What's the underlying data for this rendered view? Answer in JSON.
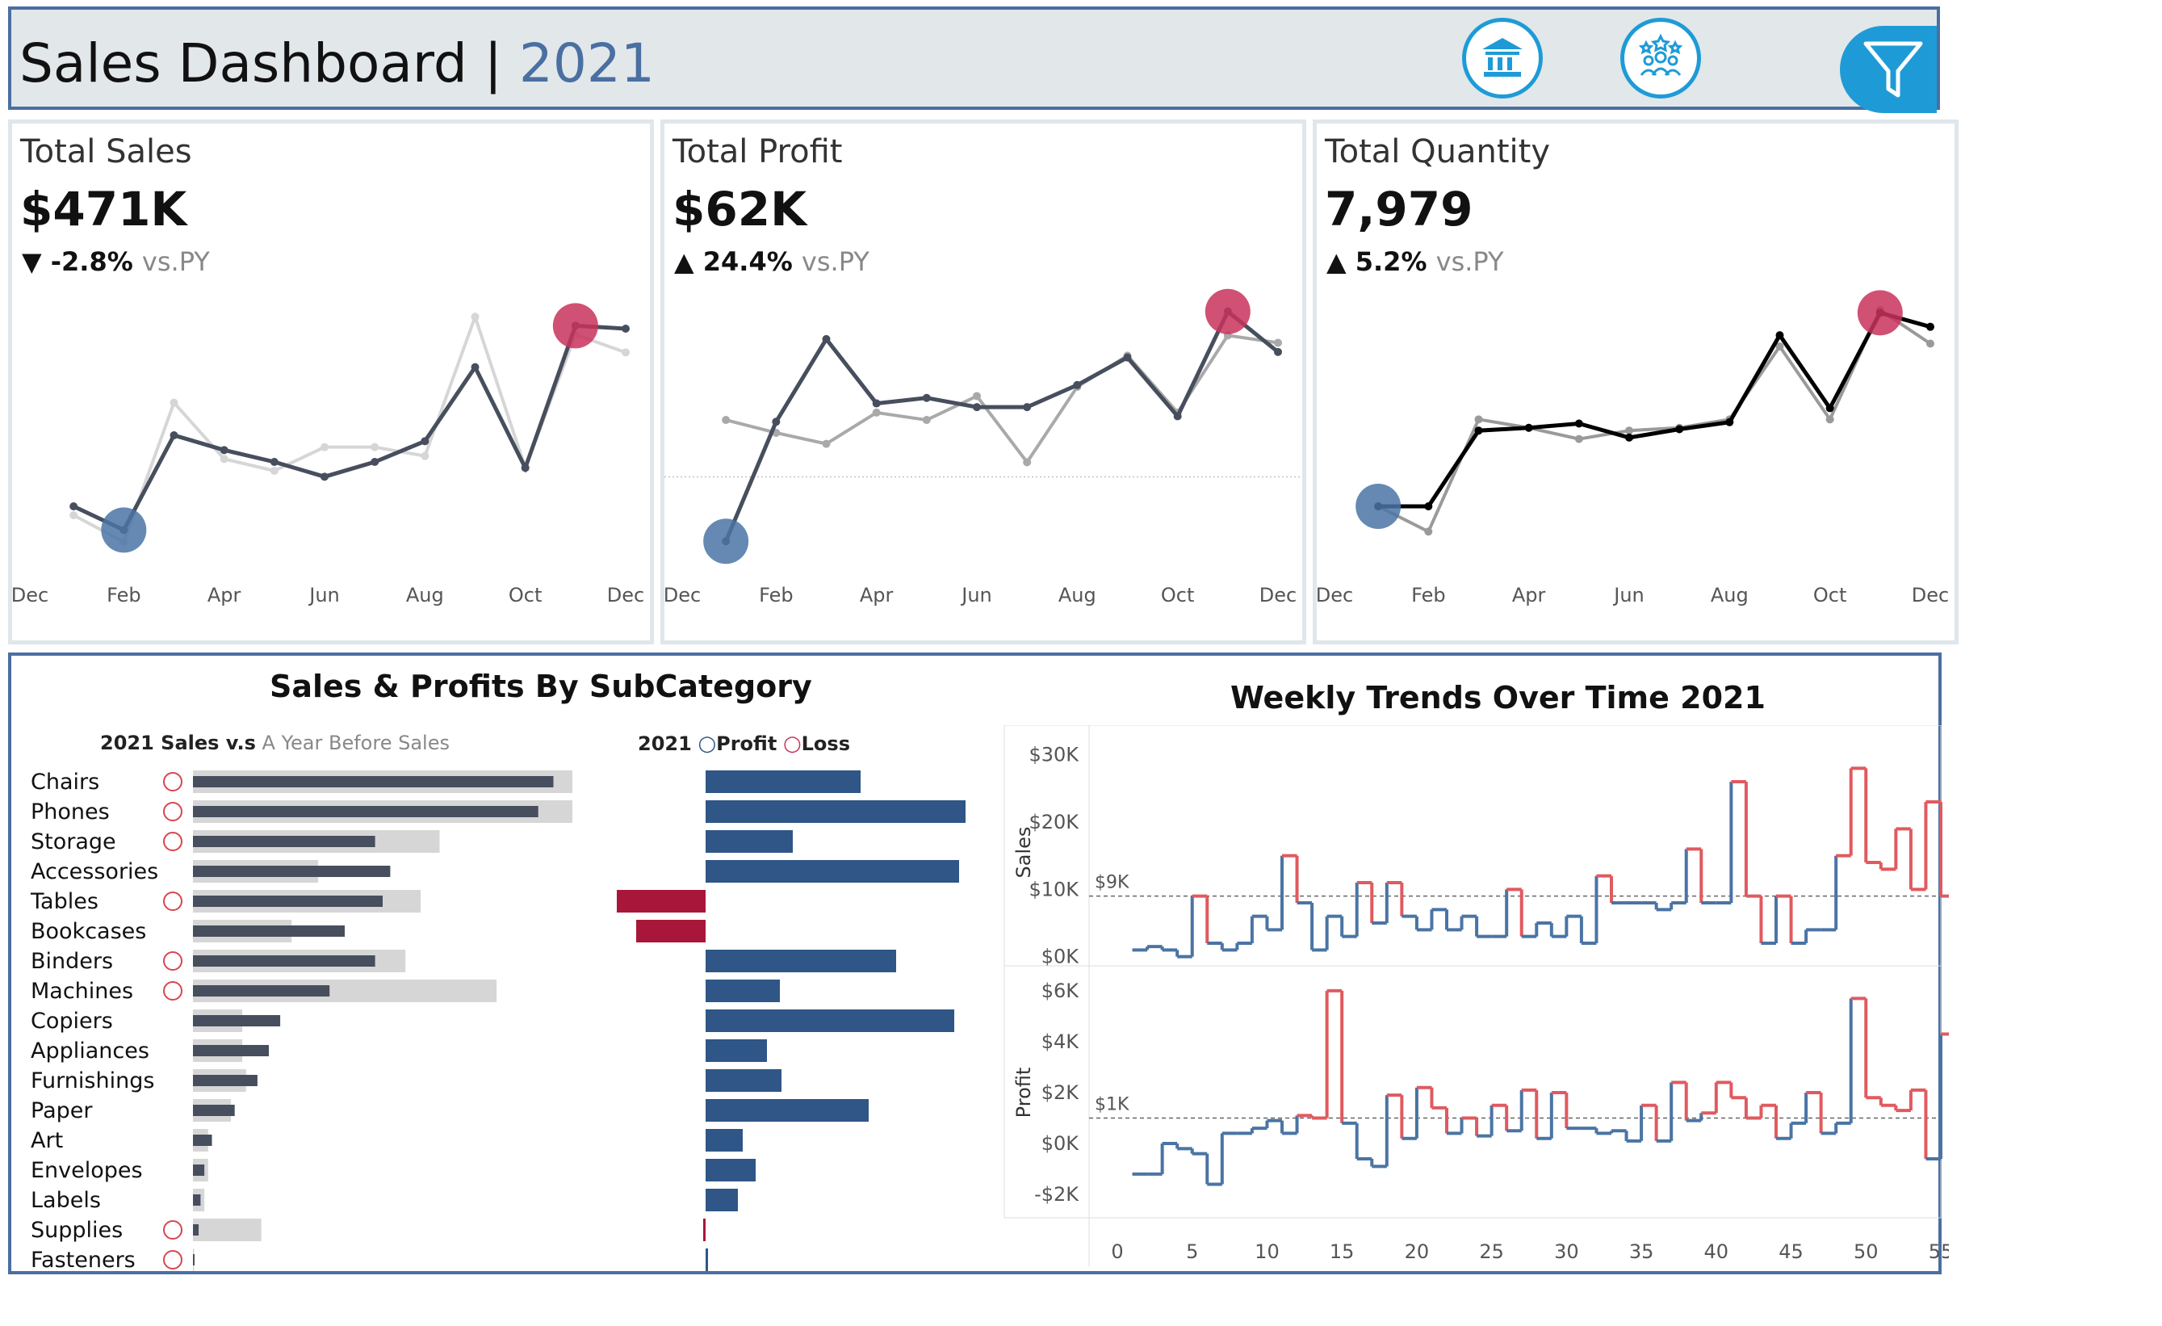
{
  "header": {
    "title": "Sales Dashboard",
    "sep": " | ",
    "year": "2021",
    "icons": [
      "bank-icon",
      "team-stars-icon",
      "filter-icon"
    ]
  },
  "kpis": [
    {
      "label": "Total Sales",
      "value": "$471K",
      "arrow": "▼",
      "change": "-2.8%",
      "vs": "vs.PY"
    },
    {
      "label": "Total Profit",
      "value": "$62K",
      "arrow": "▲",
      "change": "24.4%",
      "vs": "vs.PY"
    },
    {
      "label": "Total Quantity",
      "value": "7,979",
      "arrow": "▲",
      "change": "5.2%",
      "vs": "vs.PY"
    }
  ],
  "colors": {
    "accent": "#4a6fa1",
    "highlight": "#c8325a",
    "lowpoint": "#4a74a4",
    "profit": "#2f5686",
    "loss": "#a8173a",
    "prev": "#d6d6d6",
    "cur": "#474e5d",
    "line_red": "#e05a5f"
  },
  "chart_data": [
    {
      "type": "line",
      "title": "Total Sales",
      "x": [
        "Dec",
        "Jan",
        "Feb",
        "Mar",
        "Apr",
        "May",
        "Jun",
        "Jul",
        "Aug",
        "Sep",
        "Oct",
        "Nov",
        "Dec"
      ],
      "xticks": [
        "Dec",
        "Feb",
        "Apr",
        "Jun",
        "Aug",
        "Oct",
        "Dec"
      ],
      "series": [
        {
          "values": [
            null,
            18,
            10,
            42,
            37,
            33,
            28,
            33,
            40,
            65,
            31,
            79,
            78
          ]
        },
        {
          "values": [
            null,
            15,
            6,
            53,
            34,
            30,
            38,
            38,
            35,
            82,
            31,
            76,
            70
          ]
        }
      ],
      "ylim": [
        0,
        90
      ],
      "highlight_max": "Nov",
      "highlight_min": "Feb"
    },
    {
      "type": "line",
      "title": "Total Profit",
      "x": [
        "Dec",
        "Jan",
        "Feb",
        "Mar",
        "Apr",
        "May",
        "Jun",
        "Jul",
        "Aug",
        "Sep",
        "Oct",
        "Nov",
        "Dec"
      ],
      "xticks": [
        "Dec",
        "Feb",
        "Apr",
        "Jun",
        "Aug",
        "Oct",
        "Dec"
      ],
      "series": [
        {
          "values": [
            null,
            -3.5,
            3,
            7.5,
            4,
            4.3,
            3.8,
            3.8,
            5,
            6.5,
            3.3,
            9,
            6.8
          ]
        },
        {
          "values": [
            null,
            3.1,
            2.4,
            1.8,
            3.5,
            3.1,
            4.4,
            0.8,
            4.9,
            6.6,
            3.5,
            7.7,
            7.3
          ]
        }
      ],
      "ylim": [
        -4.5,
        10
      ],
      "highlight_max": "Nov",
      "highlight_min": "Jan"
    },
    {
      "type": "line",
      "title": "Total Quantity",
      "x": [
        "Dec",
        "Jan",
        "Feb",
        "Mar",
        "Apr",
        "May",
        "Jun",
        "Jul",
        "Aug",
        "Sep",
        "Oct",
        "Nov",
        "Dec"
      ],
      "xticks": [
        "Dec",
        "Feb",
        "Apr",
        "Jun",
        "Aug",
        "Oct",
        "Dec"
      ],
      "series": [
        {
          "values": [
            null,
            290,
            290,
            560,
            570,
            585,
            535,
            565,
            590,
            900,
            640,
            980,
            930
          ]
        },
        {
          "values": [
            null,
            290,
            200,
            600,
            570,
            530,
            560,
            570,
            600,
            860,
            600,
            990,
            870
          ]
        }
      ],
      "ylim": [
        100,
        1050
      ],
      "highlight_max": "Nov",
      "highlight_min": "Jan"
    },
    {
      "type": "bar",
      "title": "Sales & Profits By SubCategory",
      "subtitle_bold": "2021 Sales v.s",
      "subtitle_light": "A Year Before Sales",
      "categories": [
        "Chairs",
        "Phones",
        "Storage",
        "Accessories",
        "Tables",
        "Bookcases",
        "Binders",
        "Machines",
        "Copiers",
        "Appliances",
        "Furnishings",
        "Paper",
        "Art",
        "Envelopes",
        "Labels",
        "Supplies",
        "Fasteners"
      ],
      "series": [
        {
          "name": "2021",
          "values": [
            95,
            91,
            48,
            52,
            50,
            40,
            48,
            36,
            23,
            20,
            17,
            11,
            5,
            3,
            2,
            1.5,
            0.4
          ]
        },
        {
          "name": "A Year Before",
          "values": [
            100,
            100,
            65,
            33,
            60,
            26,
            56,
            80,
            13,
            13,
            14,
            10,
            4,
            4,
            3,
            18,
            0.3
          ]
        }
      ],
      "loss_marker": [
        true,
        true,
        true,
        false,
        true,
        false,
        true,
        true,
        false,
        false,
        false,
        false,
        false,
        false,
        false,
        true,
        true
      ]
    },
    {
      "type": "bar",
      "legend_year": "2021",
      "legend": [
        "Profit",
        "Loss"
      ],
      "categories": [
        "Chairs",
        "Phones",
        "Storage",
        "Accessories",
        "Tables",
        "Bookcases",
        "Binders",
        "Machines",
        "Copiers",
        "Appliances",
        "Furnishings",
        "Paper",
        "Art",
        "Envelopes",
        "Labels",
        "Supplies",
        "Fasteners"
      ],
      "values": [
        9.6,
        16.1,
        5.4,
        15.7,
        -5.5,
        -4.3,
        11.8,
        4.6,
        15.4,
        3.8,
        4.7,
        10.1,
        2.3,
        3.1,
        2.0,
        -0.1,
        0.1
      ]
    },
    {
      "type": "line",
      "title": "Weekly Trends Over Time 2021",
      "panels": [
        {
          "ylabel": "Sales",
          "yticks": [
            "$30K",
            "$20K",
            "$10K",
            "$0K"
          ],
          "ylim": [
            -1,
            32
          ],
          "ref": 9,
          "ref_label": "$9K",
          "values": [
            1,
            1.5,
            1,
            0,
            9,
            2,
            1,
            2,
            6,
            4,
            15,
            8,
            1,
            6,
            3,
            11,
            5,
            11,
            6,
            4,
            7,
            4,
            6,
            3,
            3,
            10,
            3,
            5,
            3,
            6,
            2,
            12,
            8,
            8,
            8,
            7,
            8,
            16,
            8,
            8,
            26,
            9,
            2,
            9,
            2,
            4,
            4,
            15,
            28,
            14,
            13,
            19,
            10,
            23,
            9
          ]
        },
        {
          "ylabel": "Profit",
          "yticks": [
            "$6K",
            "$4K",
            "$2K",
            "$0K",
            "-$2K"
          ],
          "ylim": [
            -2.6,
            6.6
          ],
          "ref": 1,
          "ref_label": "$1K",
          "values": [
            -1.2,
            -1.2,
            0,
            -0.2,
            -0.4,
            -1.6,
            0.4,
            0.4,
            0.6,
            0.9,
            0.4,
            1.1,
            1,
            6,
            0.8,
            -0.6,
            -0.9,
            1.9,
            0.2,
            2.2,
            1.4,
            0.4,
            1,
            0.3,
            1.5,
            0.5,
            2.1,
            0.2,
            2,
            0.6,
            0.6,
            0.4,
            0.5,
            0.1,
            1.5,
            0.1,
            2.4,
            0.9,
            1.2,
            2.4,
            1.8,
            1,
            1.5,
            0.2,
            0.8,
            2,
            0.4,
            0.8,
            5.7,
            1.8,
            1.5,
            1.3,
            2.1,
            -0.6,
            4.3,
            1
          ]
        }
      ],
      "xticks": [
        "0",
        "5",
        "10",
        "15",
        "20",
        "25",
        "30",
        "35",
        "40",
        "45",
        "50",
        "55"
      ],
      "xlim": [
        0,
        55
      ]
    }
  ]
}
